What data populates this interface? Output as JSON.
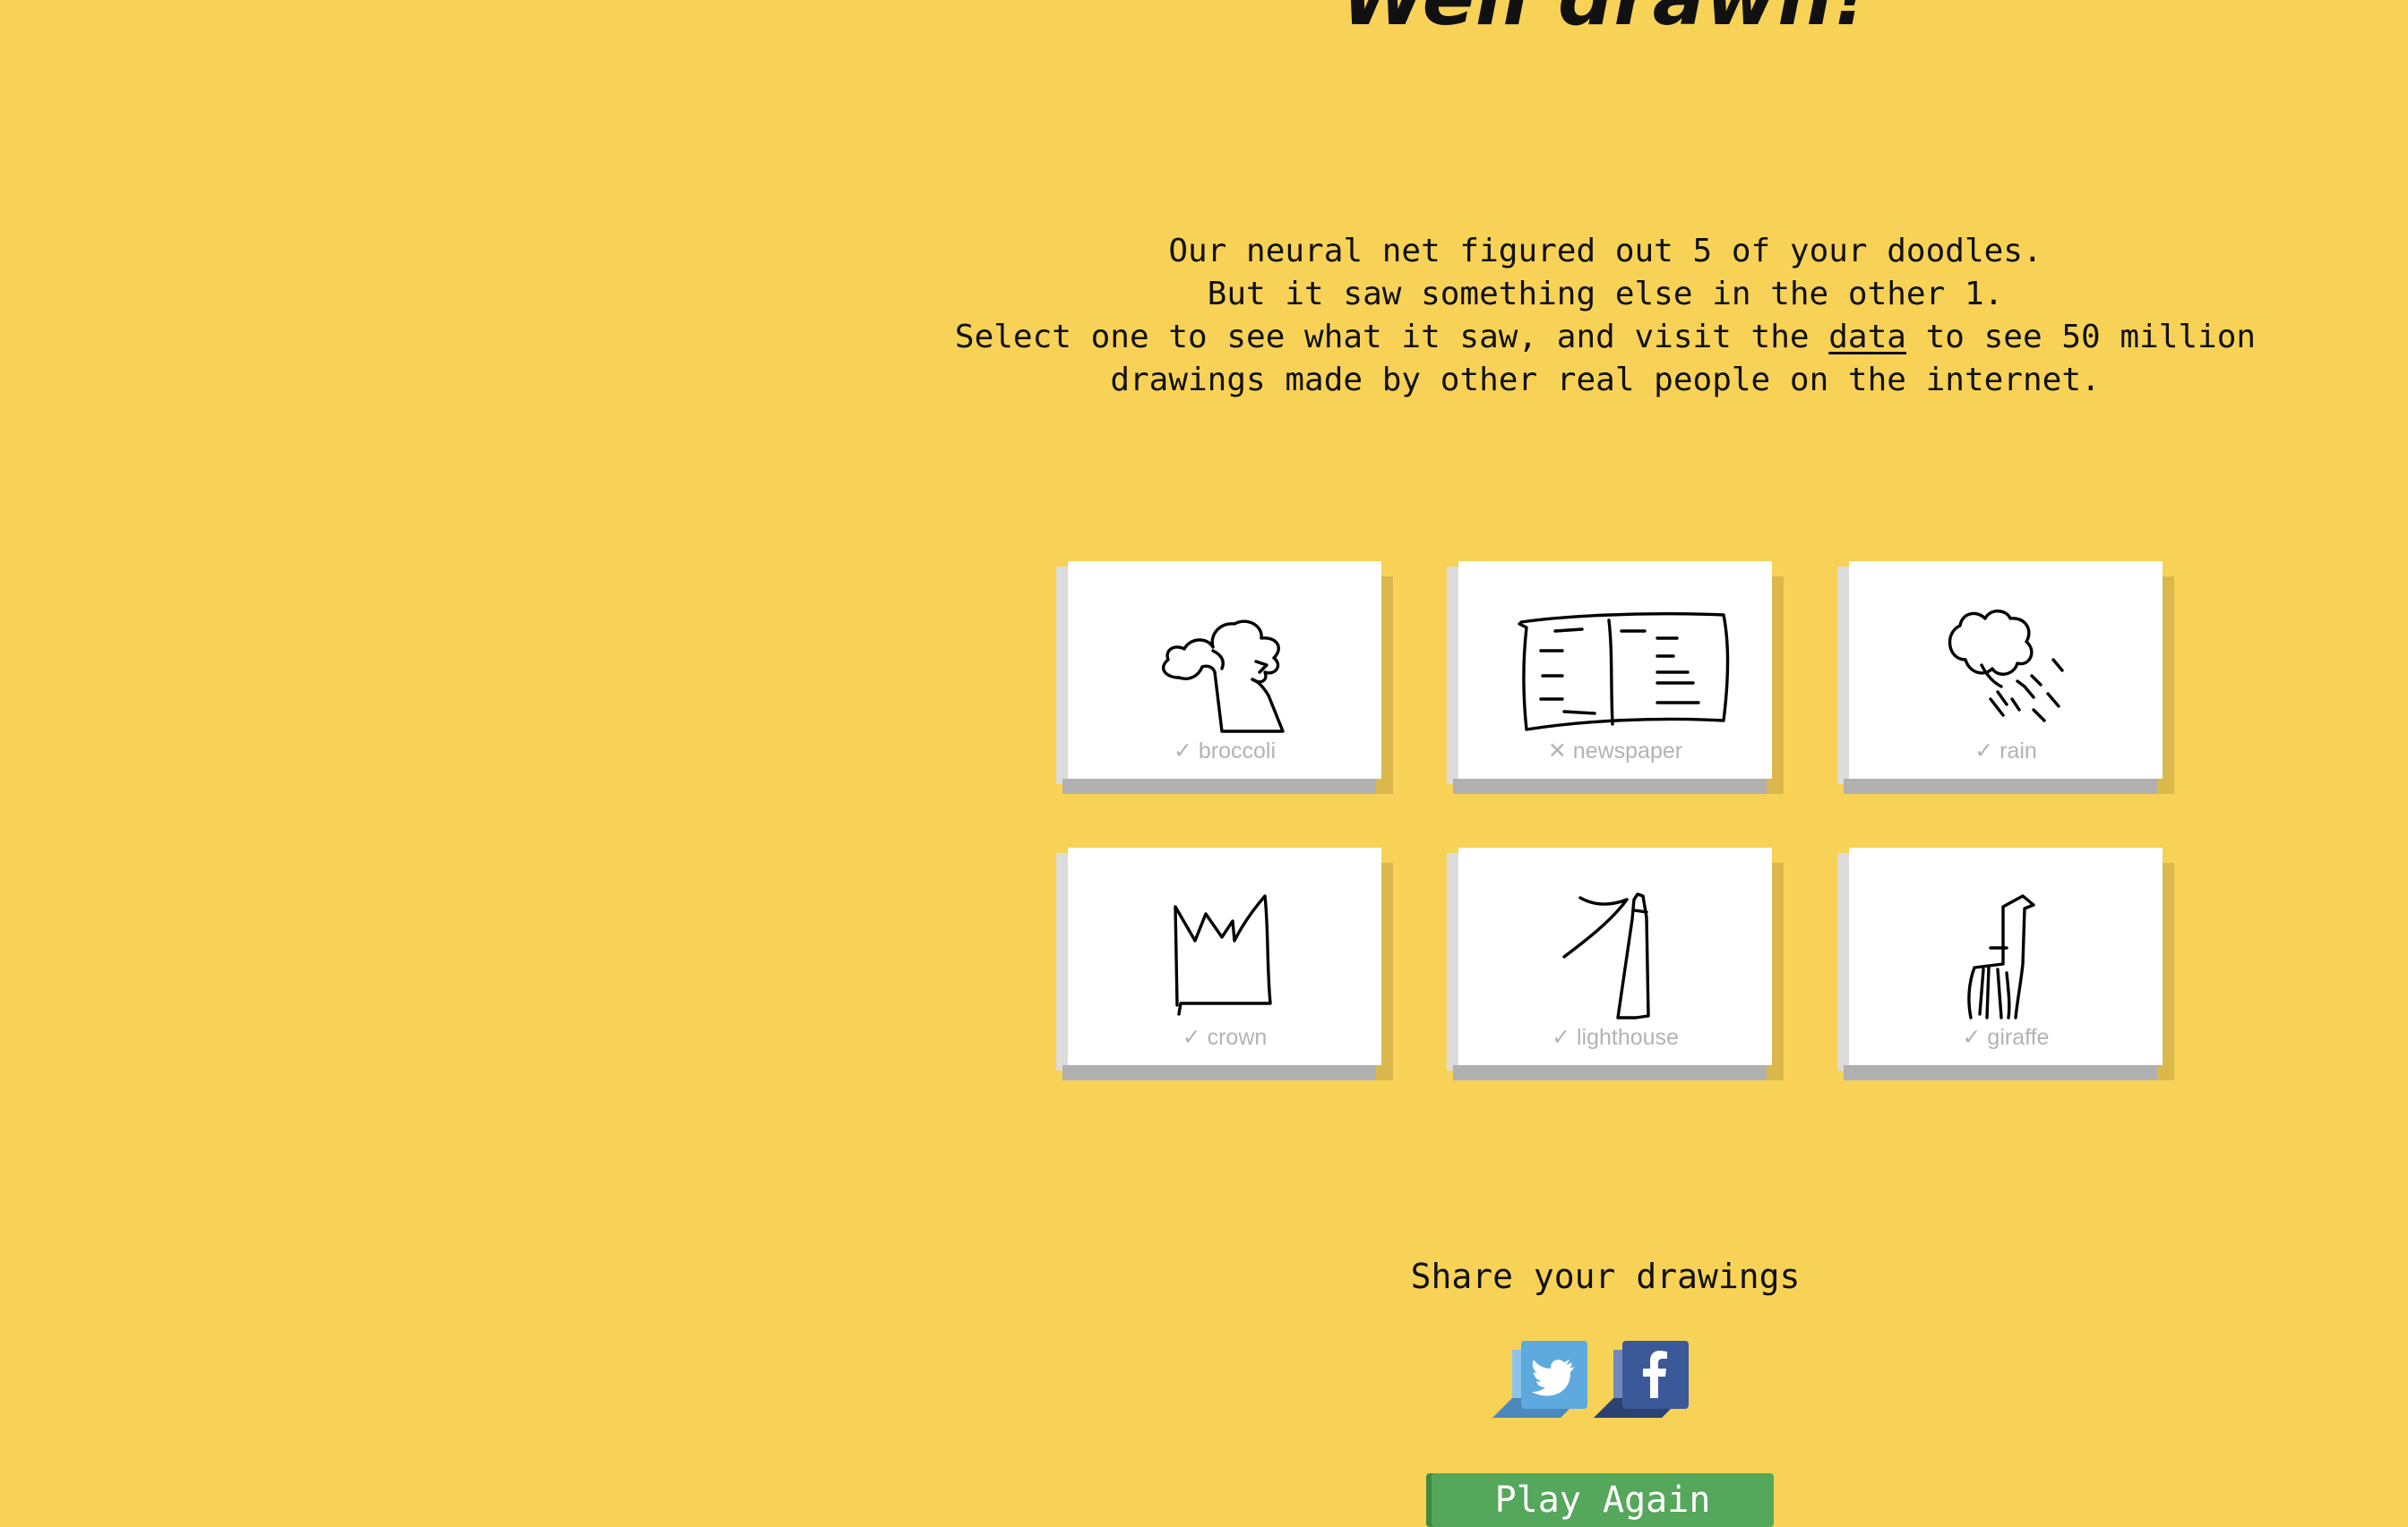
{
  "title": "Well drawn!",
  "intro": {
    "line1": "Our neural net figured out 5 of your doodles.",
    "line2": "But it saw something else in the other 1.",
    "line3_before": "Select one to see what it saw, and visit the ",
    "line3_link": "data",
    "line3_after": " to see 50 million",
    "line4": "drawings made by other real people on the internet."
  },
  "drawings": [
    {
      "label": "✓ broccoli",
      "icon": "broccoli-doodle"
    },
    {
      "label": "✕ newspaper",
      "icon": "newspaper-doodle"
    },
    {
      "label": "✓ rain",
      "icon": "rain-doodle"
    },
    {
      "label": "✓ crown",
      "icon": "crown-doodle"
    },
    {
      "label": "✓ lighthouse",
      "icon": "lighthouse-doodle"
    },
    {
      "label": "✓ giraffe",
      "icon": "giraffe-doodle"
    }
  ],
  "share": {
    "label": "Share your drawings",
    "twitter_icon": "twitter-icon",
    "facebook_icon": "facebook-icon"
  },
  "play_again": "Play Again",
  "colors": {
    "background": "#f7d257",
    "card": "#ffffff",
    "caption": "#b3b3b3",
    "play_button": "#55a75b",
    "twitter": "#5ea9dd",
    "facebook": "#3b5998"
  }
}
